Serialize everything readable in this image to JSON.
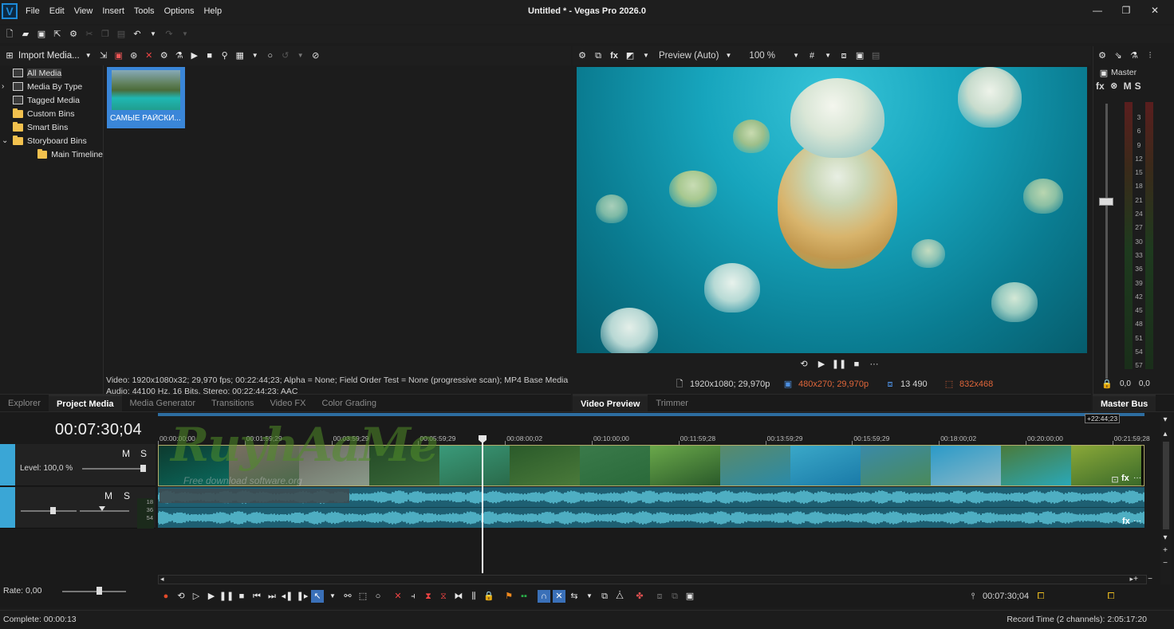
{
  "app": {
    "title": "Untitled * - Vegas Pro 2026.0",
    "logo_letter": "V",
    "menus": [
      "File",
      "Edit",
      "View",
      "Insert",
      "Tools",
      "Options",
      "Help"
    ],
    "window_controls": [
      "—",
      "❐",
      "✕"
    ]
  },
  "project_media": {
    "import_label": "Import Media...",
    "tree": [
      {
        "label": "All Media",
        "icon": "multi",
        "indent": 1,
        "selected": true,
        "expander": ""
      },
      {
        "label": "Media By Type",
        "icon": "multi",
        "indent": 1,
        "selected": false,
        "expander": "›"
      },
      {
        "label": "Tagged Media",
        "icon": "multi",
        "indent": 1,
        "selected": false,
        "expander": ""
      },
      {
        "label": "Custom Bins",
        "icon": "folder",
        "indent": 1,
        "selected": false,
        "expander": ""
      },
      {
        "label": "Smart Bins",
        "icon": "folder",
        "indent": 1,
        "selected": false,
        "expander": ""
      },
      {
        "label": "Storyboard Bins",
        "icon": "folder",
        "indent": 1,
        "selected": false,
        "expander": "⌄"
      },
      {
        "label": "Main Timeline",
        "icon": "folder",
        "indent": 2,
        "selected": false,
        "expander": ""
      }
    ],
    "thumbnail_label": "САМЫЕ РАЙСКИ...",
    "info_line1": "Video: 1920x1080x32; 29,970 fps; 00:22:44;23; Alpha = None; Field Order Test = None (progressive scan); MP4 Base Media",
    "info_line2": "Audio: 44100 Hz, 16 Bits, Stereo; 00:22:44;23; AAC"
  },
  "tabs_left": [
    {
      "label": "Explorer",
      "active": false
    },
    {
      "label": "Project Media",
      "active": true
    },
    {
      "label": "Media Generator",
      "active": false
    },
    {
      "label": "Transitions",
      "active": false
    },
    {
      "label": "Video FX",
      "active": false
    },
    {
      "label": "Color Grading",
      "active": false
    }
  ],
  "tabs_mid": [
    {
      "label": "Video Preview",
      "active": true
    },
    {
      "label": "Trimmer",
      "active": false
    }
  ],
  "tabs_right": [
    {
      "label": "Master Bus",
      "active": true
    }
  ],
  "preview": {
    "quality_label": "Preview (Auto)",
    "zoom_label": "100 %",
    "project_res": "1920x1080; 29,970p",
    "preview_res": "480x270; 29,970p",
    "frame_num": "13 490",
    "display_size": "832x468",
    "preview_res_color": "#e0663a",
    "display_size_color": "#e0663a"
  },
  "master": {
    "label": "Master",
    "fx": "fx",
    "m": "M",
    "s": "S",
    "scale": [
      "3",
      "6",
      "9",
      "12",
      "15",
      "18",
      "21",
      "24",
      "27",
      "30",
      "33",
      "36",
      "39",
      "42",
      "45",
      "48",
      "51",
      "54",
      "57"
    ],
    "left_val": "0,0",
    "right_val": "0,0"
  },
  "timeline": {
    "timecode": "00:07:30;04",
    "end_time": "+22:44;23",
    "ruler": [
      "00:00:00;00",
      "00:01:59;29",
      "00:03:59;29",
      "00:05:59;29",
      "00:08:00;02",
      "00:10:00;00",
      "00:11:59;28",
      "00:13:59;29",
      "00:15:59;29",
      "00:18:00;02",
      "00:20:00;00",
      "00:21:59;28"
    ],
    "video_track": {
      "level_label": "Level: 100,0 %",
      "m": "M",
      "s": "S"
    },
    "audio_track": {
      "m": "M",
      "s": "S",
      "meter_labels": [
        "18",
        "36",
        "54"
      ]
    },
    "rate_label": "Rate: 0,00",
    "cursor_timecode": "00:07:30;04",
    "clip_fx": "fx",
    "clip_more": "···"
  },
  "watermark": {
    "text": "RuyhAaMe",
    "sub": "Free download software.org"
  },
  "status": {
    "left": "Complete: 00:00:13",
    "right": "Record Time (2 channels): 2:05:17:20"
  }
}
